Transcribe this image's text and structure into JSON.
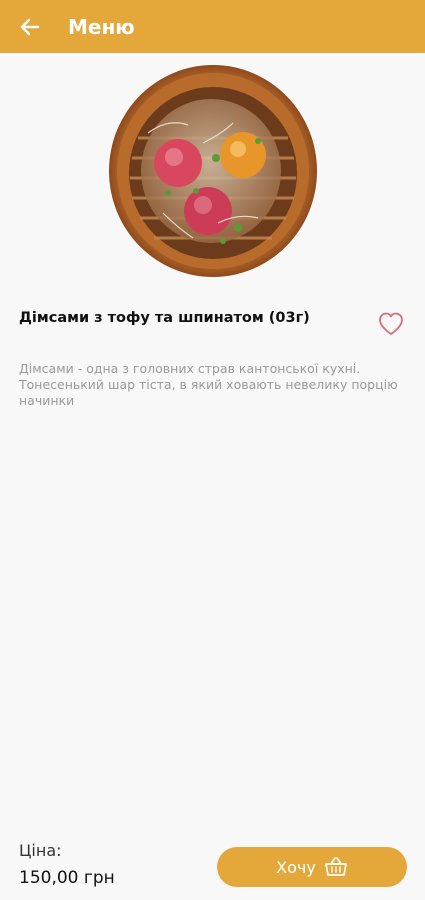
{
  "app_bar": {
    "title": "Меню",
    "back_icon": "arrow-left-icon",
    "background_color": "#e3a73a"
  },
  "dish": {
    "image": "dimsum-steamer-image",
    "title": "Дімсами з тофу та шпинатом (03г)",
    "favorite_icon": "heart-outline-icon",
    "description": "Дімсами - одна з головних страв кантонської кухні. Тонесенький шар тіста, в який ховають невелику порцію начинки"
  },
  "footer": {
    "price_label": "Ціна:",
    "price_value": "150,00 грн",
    "want_button_label": "Хочу",
    "basket_icon": "basket-icon",
    "button_color": "#e3a73a"
  }
}
